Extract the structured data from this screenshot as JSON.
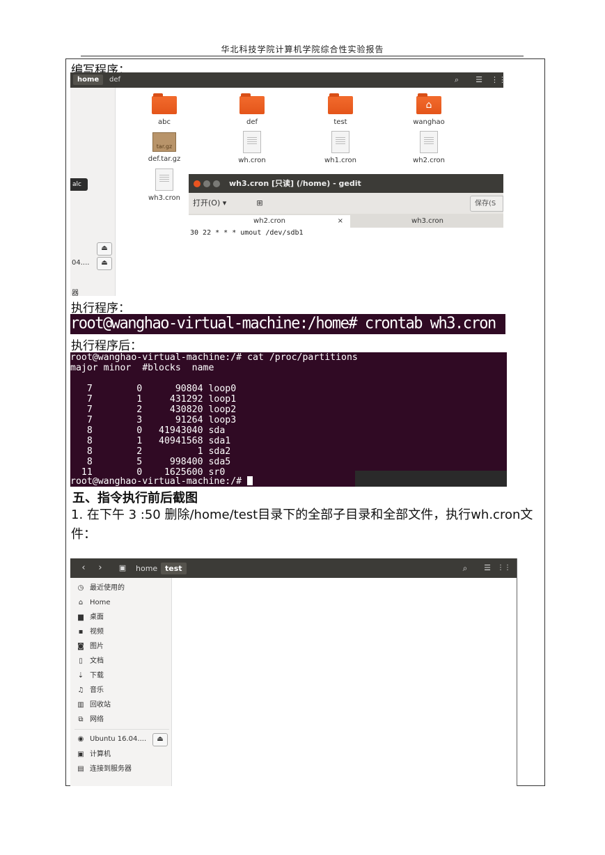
{
  "page_header": "华北科技学院计算机学院综合性实验报告",
  "label_write": "编写程序：",
  "label_run": "执行程序：",
  "label_after": "执行程序后：",
  "fm1": {
    "crumbs": [
      "home",
      "def"
    ],
    "files": [
      {
        "name": "abc",
        "kind": "folder"
      },
      {
        "name": "def",
        "kind": "folder"
      },
      {
        "name": "test",
        "kind": "folder"
      },
      {
        "name": "wanghao",
        "kind": "home-folder"
      },
      {
        "name": "def.tar.gz",
        "kind": "archive"
      },
      {
        "name": "wh.cron",
        "kind": "doc"
      },
      {
        "name": "wh1.cron",
        "kind": "doc"
      },
      {
        "name": "wh2.cron",
        "kind": "doc"
      },
      {
        "name": "wh3.cron",
        "kind": "doc"
      }
    ],
    "archive_badge": "tar.gz",
    "side_button": "alc",
    "side_device": "04....",
    "side_bottom": "器"
  },
  "gedit": {
    "title": "wh3.cron [只读] (/home) - gedit",
    "open_label": "打开(O)",
    "save_label": "保存(S",
    "tabs": [
      "wh2.cron",
      "wh3.cron"
    ],
    "tab_close": "×",
    "content": "30 22 * * * umout /dev/sdb1"
  },
  "term1": {
    "text": "root@wanghao-virtual-machine:/home# crontab wh3.cron"
  },
  "term2": {
    "lines": [
      "root@wanghao-virtual-machine:/# cat /proc/partitions",
      "major minor  #blocks  name",
      "",
      "   7        0      90804 loop0",
      "   7        1     431292 loop1",
      "   7        2     430820 loop2",
      "   7        3      91264 loop3",
      "   8        0   41943040 sda",
      "   8        1   40941568 sda1",
      "   8        2          1 sda2",
      "   8        5     998400 sda5",
      "  11        0    1625600 sr0"
    ],
    "prompt": "root@wanghao-virtual-machine:/# "
  },
  "section_title": "五、指令执行前后截图",
  "paragraph": "1. 在下午 3 :50 删除/home/test目录下的全部子目录和全部文件，执行wh.cron文件：",
  "fm2": {
    "crumbs": [
      "home",
      "test"
    ],
    "side": [
      {
        "icon": "clock-icon",
        "glyph": "◷",
        "label": "最近使用的"
      },
      {
        "icon": "home-icon",
        "glyph": "⌂",
        "label": "Home"
      },
      {
        "icon": "desktop-folder-icon",
        "glyph": "▆",
        "label": "桌面"
      },
      {
        "icon": "video-icon",
        "glyph": "▪",
        "label": "视频"
      },
      {
        "icon": "camera-icon",
        "glyph": "◙",
        "label": "图片"
      },
      {
        "icon": "document-icon",
        "glyph": "▯",
        "label": "文档"
      },
      {
        "icon": "download-icon",
        "glyph": "⇣",
        "label": "下载"
      },
      {
        "icon": "music-icon",
        "glyph": "♫",
        "label": "音乐"
      },
      {
        "icon": "trash-icon",
        "glyph": "▥",
        "label": "回收站"
      },
      {
        "icon": "network-icon",
        "glyph": "⧉",
        "label": "网络"
      },
      {
        "icon": "disc-icon",
        "glyph": "◉",
        "label": "Ubuntu 16.04...."
      },
      {
        "icon": "computer-icon",
        "glyph": "▣",
        "label": "计算机"
      },
      {
        "icon": "server-icon",
        "glyph": "▤",
        "label": "连接到服务器"
      }
    ]
  }
}
